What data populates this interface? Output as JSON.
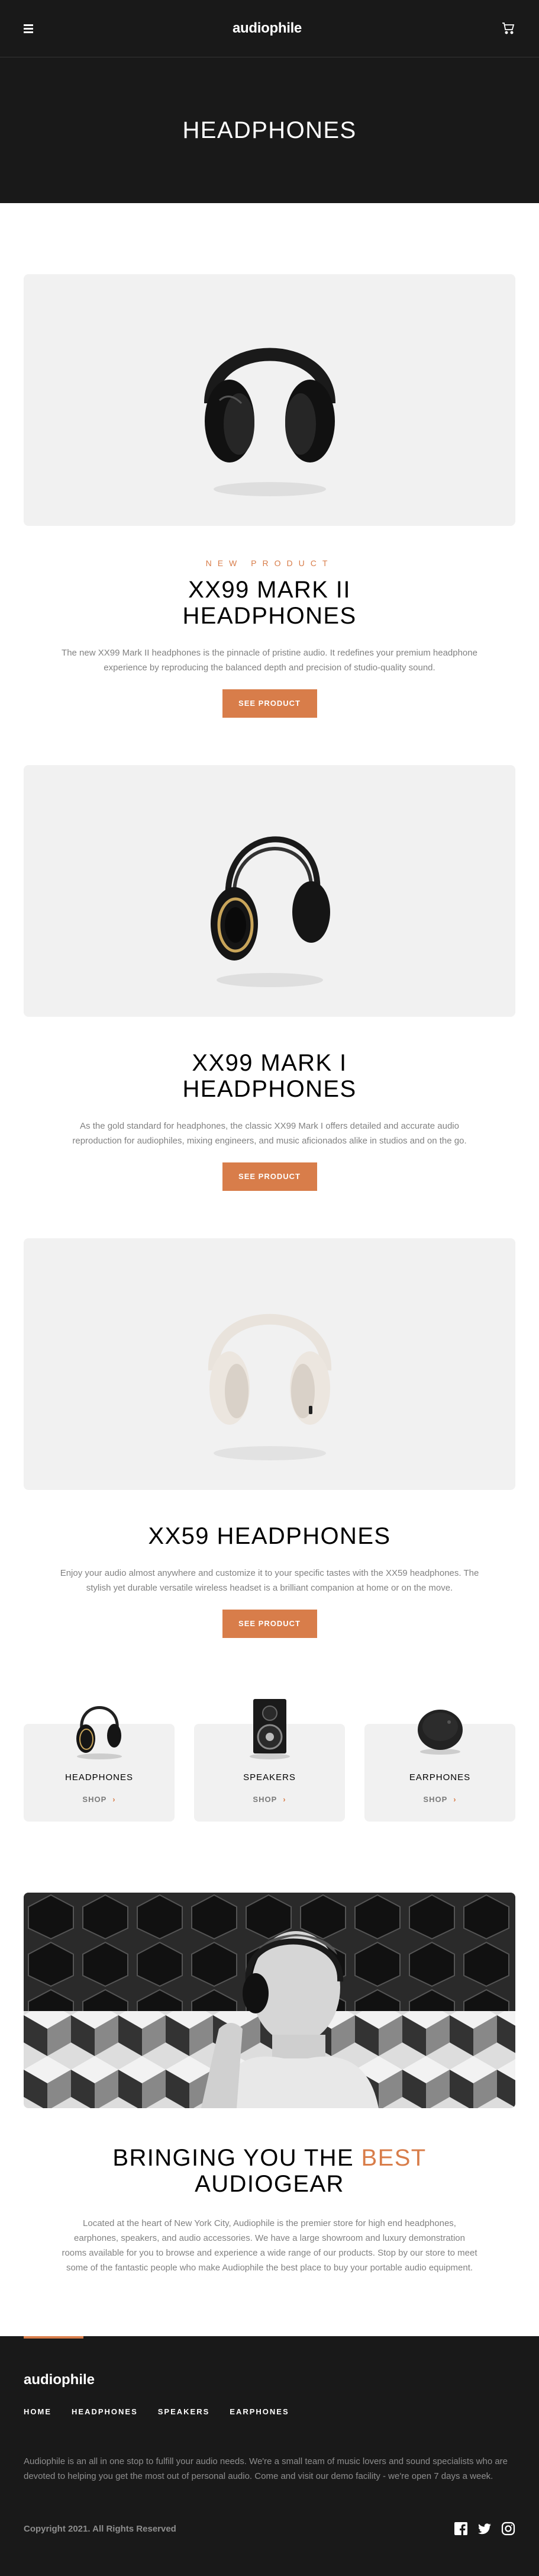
{
  "header": {
    "logo": "audiophile",
    "menu_icon": "hamburger-icon",
    "cart_icon": "cart-icon"
  },
  "hero": {
    "title": "HEADPHONES"
  },
  "products": [
    {
      "overline": "NEW PRODUCT",
      "title": "XX99 MARK II HEADPHONES",
      "description": "The new XX99 Mark II headphones is the pinnacle of pristine audio. It redefines your premium headphone experience by reproducing the balanced depth and precision of studio-quality sound.",
      "button": "SEE PRODUCT"
    },
    {
      "overline": "",
      "title": "XX99 MARK I HEADPHONES",
      "description": "As the gold standard for headphones, the classic XX99 Mark I offers detailed and accurate audio reproduction for audiophiles, mixing engineers, and music aficionados alike in studios and on the go.",
      "button": "SEE PRODUCT"
    },
    {
      "overline": "",
      "title": "XX59 HEADPHONES",
      "description": "Enjoy your audio almost anywhere and customize it to your specific tastes with the XX59 headphones. The stylish yet durable versatile wireless headset is a brilliant companion at home or on the move.",
      "button": "SEE PRODUCT"
    }
  ],
  "categories": [
    {
      "title": "HEADPHONES",
      "shop": "SHOP"
    },
    {
      "title": "SPEAKERS",
      "shop": "SHOP"
    },
    {
      "title": "EARPHONES",
      "shop": "SHOP"
    }
  ],
  "about": {
    "title_start": "BRINGING YOU THE ",
    "title_accent": "BEST",
    "title_end": "AUDIOGEAR",
    "description": "Located at the heart of New York City, Audiophile is the premier store for high end headphones, earphones, speakers, and audio accessories. We have a large showroom and luxury demonstration rooms available for you to browse and experience a wide range of our products. Stop by our store to meet some of the fantastic people who make Audiophile the best place to buy your portable audio equipment."
  },
  "footer": {
    "logo": "audiophile",
    "nav": [
      "HOME",
      "HEADPHONES",
      "SPEAKERS",
      "EARPHONES"
    ],
    "text": "Audiophile is an all in one stop to fulfill your audio needs. We're a small team of music lovers and sound specialists who are devoted to helping you get the most out of personal audio. Come and visit our demo facility - we're open 7 days a week.",
    "copyright": "Copyright 2021. All Rights Reserved",
    "socials": [
      "facebook-icon",
      "twitter-icon",
      "instagram-icon"
    ]
  },
  "colors": {
    "accent": "#d87d4a",
    "dark": "#191919",
    "light_gray": "#f1f1f1"
  }
}
